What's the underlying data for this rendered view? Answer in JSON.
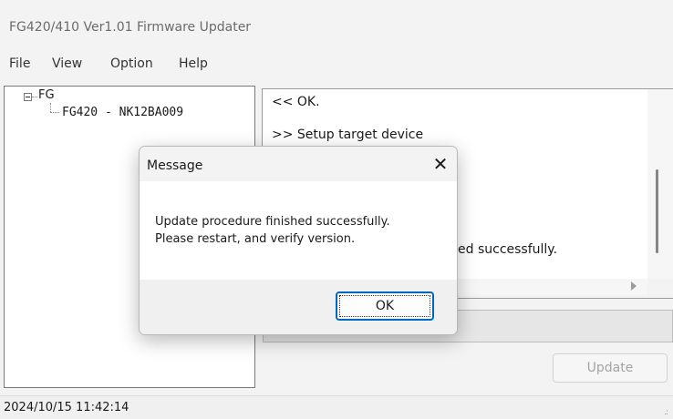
{
  "window": {
    "title": "FG420/410 Ver1.01 Firmware Updater"
  },
  "menu": {
    "items": [
      "File",
      "View",
      "Option",
      "Help"
    ]
  },
  "tree": {
    "root": "FG",
    "child": "FG420 - NK12BA009"
  },
  "log": {
    "lines": [
      "<< OK.",
      ">> Setup target device",
      "ed successfully."
    ]
  },
  "update_button": {
    "label": "Update",
    "enabled": false
  },
  "status": {
    "timestamp": "2024/10/15 11:42:14"
  },
  "dialog": {
    "title": "Message",
    "close_glyph": "✕",
    "message_line1": "Update procedure finished successfully.",
    "message_line2": "Please restart, and verify version.",
    "ok_label": "OK"
  },
  "colors": {
    "accent": "#0067c0",
    "disabled_text": "#a3a3a3"
  }
}
